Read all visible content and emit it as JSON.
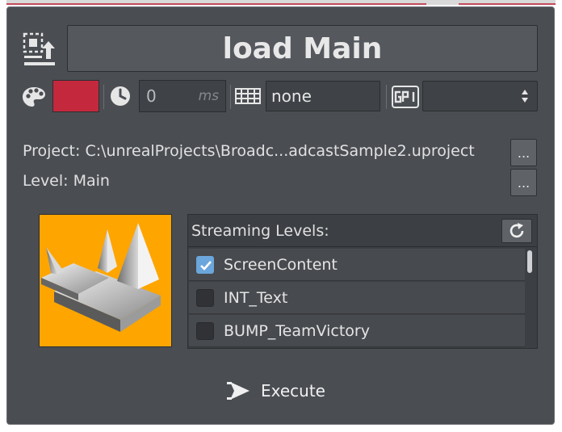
{
  "header": {
    "title": "load Main",
    "load_icon": "load-template-icon"
  },
  "controls": {
    "palette_icon": "palette-icon",
    "color": "#c4283d",
    "clock_icon": "clock-icon",
    "delay_value": "0",
    "delay_unit": "ms",
    "grid_icon": "grid-icon",
    "channel_value": "none",
    "gpi_icon": "gpi-icon",
    "gpi_selected": ""
  },
  "project": {
    "label": "Project:",
    "path": "C:\\unrealProjects\\Broadc...adcastSample2.uproject",
    "browse_label": "..."
  },
  "level": {
    "label": "Level:",
    "value": "Main",
    "browse_label": "..."
  },
  "streaming": {
    "header": "Streaming Levels:",
    "refresh_icon": "refresh-icon",
    "items": [
      {
        "label": "ScreenContent",
        "checked": true
      },
      {
        "label": "INT_Text",
        "checked": false
      },
      {
        "label": "BUMP_TeamVictory",
        "checked": false
      }
    ]
  },
  "execute": {
    "label": "Execute",
    "icon": "execute-icon"
  },
  "colors": {
    "panel_bg": "#4a4d52",
    "accent_check": "#6ba6dc",
    "thumb_bg": "#fea500"
  }
}
